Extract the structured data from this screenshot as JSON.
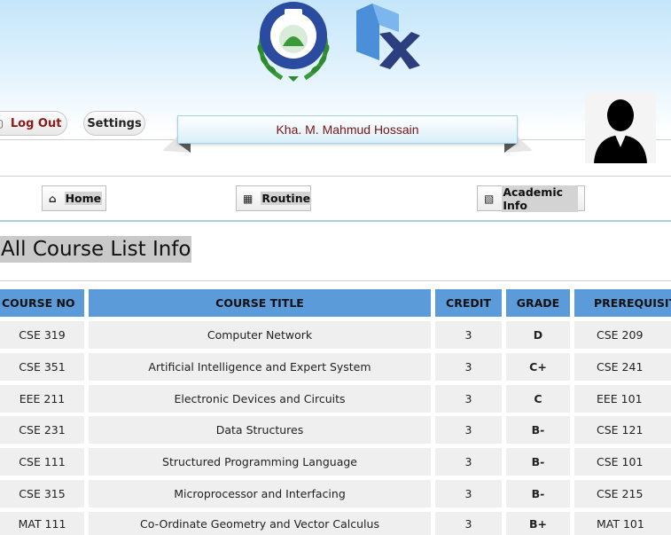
{
  "header": {
    "logout_label": "Log Out",
    "settings_label": "Settings",
    "student_name": "Kha. M. Mahmud Hossain"
  },
  "nav": {
    "home": "Home",
    "routine": "Routine",
    "academic_info": "Academic Info"
  },
  "page": {
    "title": "All Course List Info"
  },
  "table": {
    "columns": [
      "COURSE NO",
      "COURSE TITLE",
      "CREDIT",
      "GRADE",
      "PREREQUISITE"
    ],
    "rows": [
      [
        "CSE 319",
        "Computer Network",
        "3",
        "D",
        "CSE 209"
      ],
      [
        "CSE 351",
        "Artificial Intelligence and Expert System",
        "3",
        "C+",
        "CSE 241"
      ],
      [
        "EEE 211",
        "Electronic Devices and Circuits",
        "3",
        "C",
        "EEE 101"
      ],
      [
        "CSE 231",
        "Data Structures",
        "3",
        "B-",
        "CSE 121"
      ],
      [
        "CSE 111",
        "Structured Programming Language",
        "3",
        "B-",
        "CSE 101"
      ],
      [
        "CSE 315",
        "Microprocessor and Interfacing",
        "3",
        "B-",
        "CSE 215"
      ],
      [
        "MAT 111",
        "Co-Ordinate Geometry and Vector Calculus",
        "3",
        "B+",
        "MAT 101"
      ]
    ]
  },
  "colors": {
    "header_row": "#5b9bd9",
    "cell_bg": "#efefef",
    "name_text": "#7a1414"
  },
  "icons": [
    "logout-icon",
    "home-icon",
    "calendar-icon",
    "book-icon",
    "user-avatar-icon"
  ]
}
